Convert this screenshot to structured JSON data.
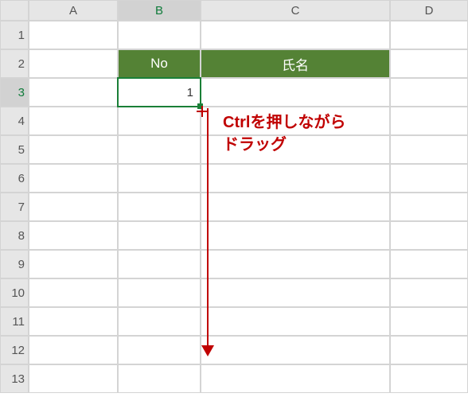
{
  "columns": {
    "A": "A",
    "B": "B",
    "C": "C",
    "D": "D"
  },
  "rows": {
    "1": "1",
    "2": "2",
    "3": "3",
    "4": "4",
    "5": "5",
    "6": "6",
    "7": "7",
    "8": "8",
    "9": "9",
    "10": "10",
    "11": "11",
    "12": "12",
    "13": "13"
  },
  "cells": {
    "B2": "No",
    "C2": "氏名",
    "B3": "1"
  },
  "selection": {
    "cell": "B3"
  },
  "annotation": {
    "line1": "Ctrlを押しながら",
    "line2": "ドラッグ"
  },
  "colors": {
    "headerFill": "#548235",
    "selectionBorder": "#1a7f37",
    "annotation": "#c00000"
  }
}
